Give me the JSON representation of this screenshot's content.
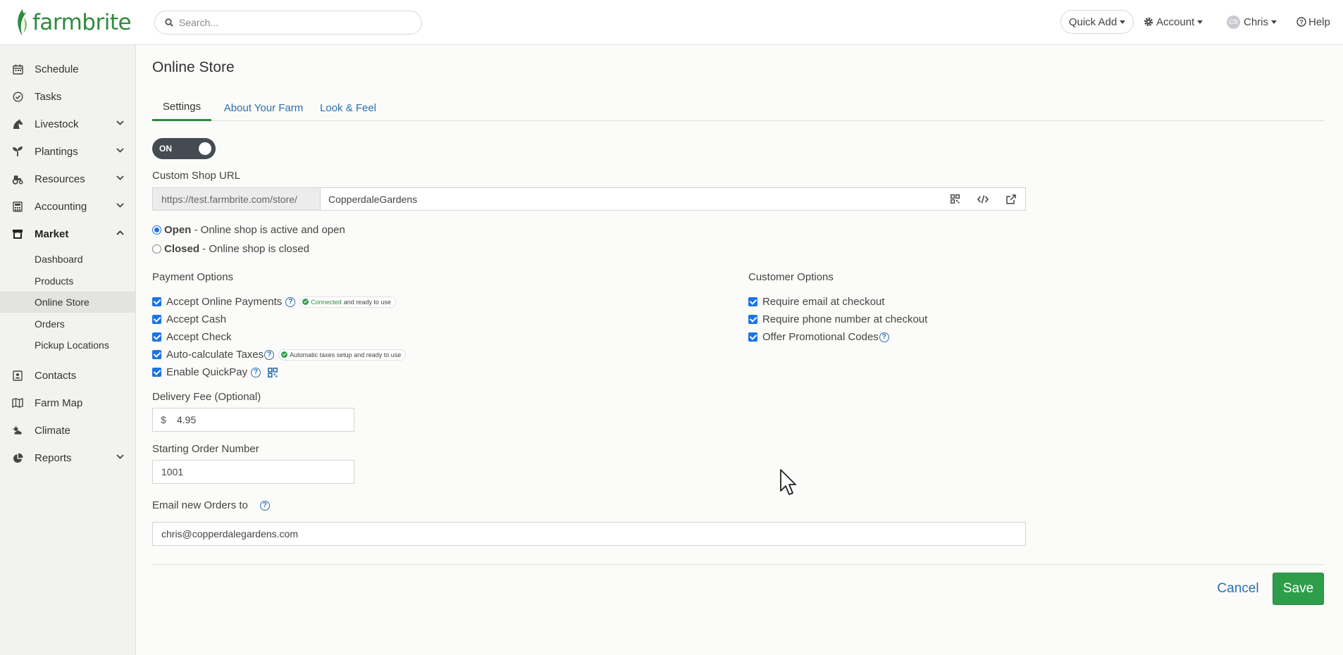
{
  "brand": {
    "logo_text": "farmbrite",
    "accent": "#2e8b3e",
    "link_color": "#2a6fb0",
    "save_color": "#2e9d4a"
  },
  "search": {
    "placeholder": "Search..."
  },
  "topbar": {
    "quick_add": "Quick Add",
    "account": "Account",
    "user_initials": "CB",
    "user": "Chris",
    "help": "Help"
  },
  "sidebar": {
    "items": [
      {
        "label": "Schedule",
        "icon": "calendar-icon"
      },
      {
        "label": "Tasks",
        "icon": "check-circle-icon"
      },
      {
        "label": "Livestock",
        "icon": "horse-icon"
      },
      {
        "label": "Plantings",
        "icon": "seedling-icon"
      },
      {
        "label": "Resources",
        "icon": "tractor-icon"
      },
      {
        "label": "Accounting",
        "icon": "calculator-icon"
      },
      {
        "label": "Market",
        "icon": "store-icon"
      },
      {
        "label": "Contacts",
        "icon": "address-book-icon"
      },
      {
        "label": "Farm Map",
        "icon": "map-icon"
      },
      {
        "label": "Climate",
        "icon": "cloud-sun-icon"
      },
      {
        "label": "Reports",
        "icon": "pie-chart-icon"
      }
    ],
    "market_sub": [
      "Dashboard",
      "Products",
      "Online Store",
      "Orders",
      "Pickup Locations"
    ]
  },
  "page": {
    "title": "Online Store",
    "tabs": [
      "Settings",
      "About Your Farm",
      "Look & Feel"
    ],
    "toggle_label": "ON",
    "custom_url_label": "Custom Shop URL",
    "url_prefix": "https://test.farmbrite.com/store/",
    "url_value": "CopperdaleGardens",
    "status_open_strong": "Open",
    "status_open_desc": " - Online shop is active and open",
    "status_closed_strong": "Closed",
    "status_closed_desc": " - Online shop is closed",
    "payment_title": "Payment Options",
    "payment_options": {
      "online": "Accept Online Payments",
      "online_status_green": "Connected",
      "online_status_rest": "and ready to use",
      "cash": "Accept Cash",
      "check": "Accept Check",
      "taxes": "Auto-calculate Taxes",
      "taxes_status": "Automatic taxes setup and ready to use",
      "quickpay": "Enable QuickPay"
    },
    "customer_title": "Customer Options",
    "customer_options": {
      "email": "Require email at checkout",
      "phone": "Require phone number at checkout",
      "promo": "Offer Promotional Codes"
    },
    "delivery_label": "Delivery Fee (Optional)",
    "currency": "$",
    "delivery_value": "4.95",
    "order_number_label": "Starting Order Number",
    "order_number_value": "1001",
    "email_label": "Email new Orders to",
    "email_value": "chris@copperdalegardens.com",
    "cancel": "Cancel",
    "save": "Save"
  }
}
